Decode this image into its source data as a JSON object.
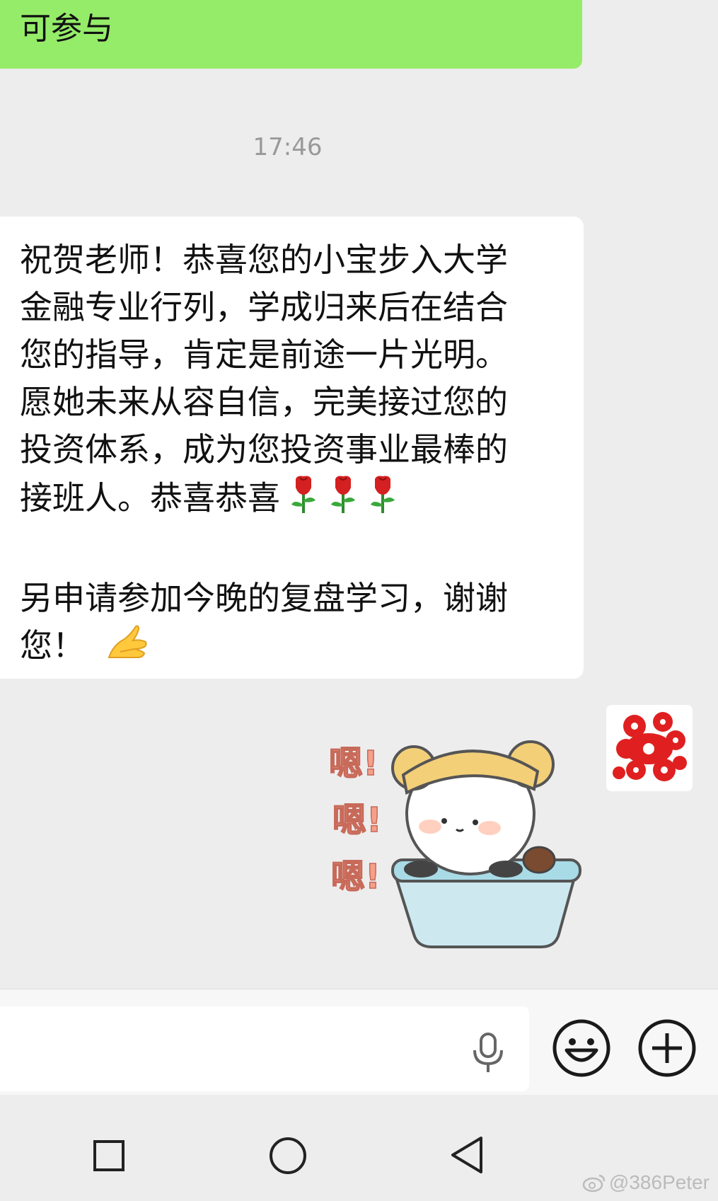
{
  "messages": {
    "prev_green": "可参与",
    "timestamp": "17:46",
    "incoming_lines": [
      "祝贺老师！恭喜您的小宝步入大学",
      "金融专业行列，学成归来后在结合",
      "您的指导，肯定是前途一片光明。",
      "愿她未来从容自信，完美接过您的",
      "投资体系，成为您投资事业最棒的",
      "接班人。恭喜恭喜"
    ],
    "incoming_lines2": [
      "另申请参加今晚的复盘学习，谢谢",
      "您！"
    ],
    "rose_emoji": "rose-icon",
    "hands_emoji": "hands-together-icon",
    "sticker_text": [
      "嗯!",
      "嗯!",
      "嗯!"
    ]
  },
  "colors": {
    "green_bubble": "#95ec69",
    "background": "#ededed"
  },
  "watermark": "@386Peter"
}
